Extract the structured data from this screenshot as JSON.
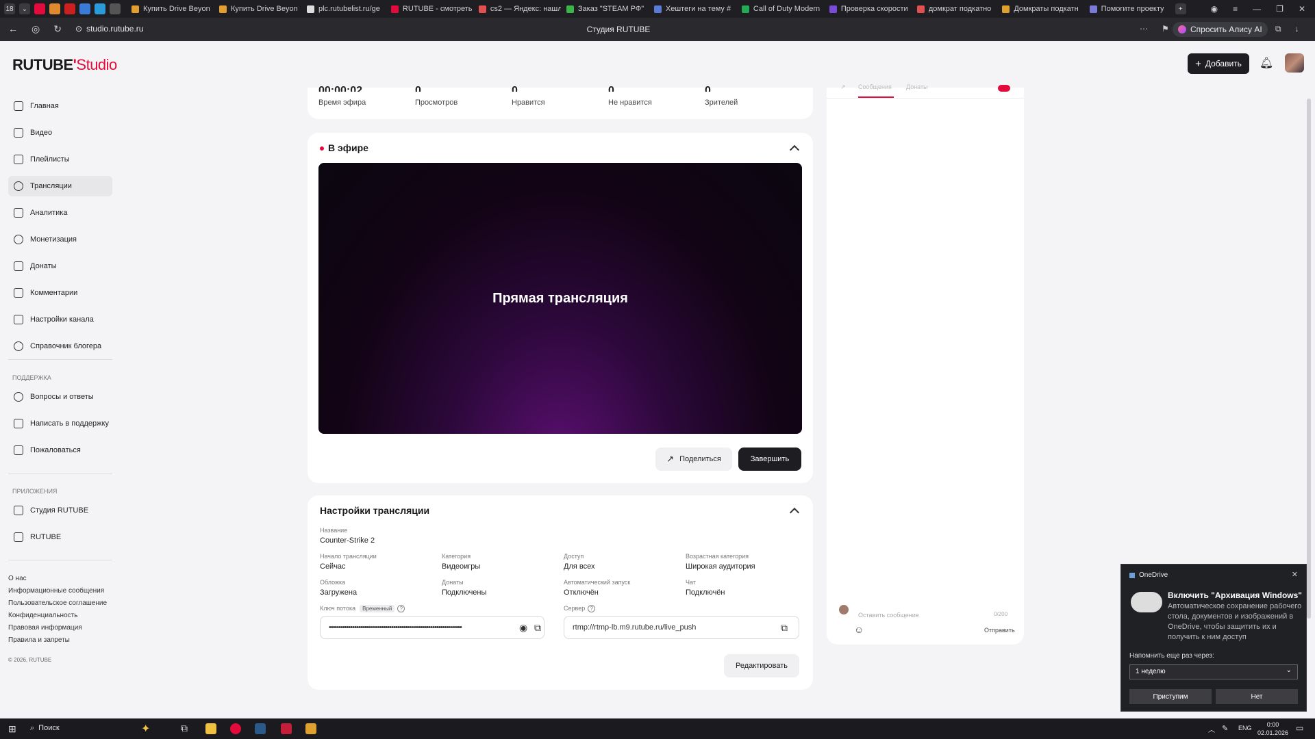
{
  "browser": {
    "tabs": [
      {
        "label": "Купить Drive Beyon",
        "color": "#e0a030"
      },
      {
        "label": "Купить Drive Beyon",
        "color": "#e0a030"
      },
      {
        "label": "plc.rutubelist.ru/ge",
        "color": "#dddddd"
      },
      {
        "label": "RUTUBE - смотреть",
        "color": "#e30b3b"
      },
      {
        "label": "cs2 — Яндекс: нашл",
        "color": "#e35050"
      },
      {
        "label": "Заказ \"STEAM РФ\"",
        "color": "#3bb54a"
      },
      {
        "label": "Хештеги на тему #",
        "color": "#5a7bd8"
      },
      {
        "label": "Call of Duty Modern",
        "color": "#22aa55"
      },
      {
        "label": "Проверка скорости",
        "color": "#7a4ad8"
      },
      {
        "label": "домкрат подкатно",
        "color": "#e35050"
      },
      {
        "label": "Домкраты подкатн",
        "color": "#e0a030"
      },
      {
        "label": "Помогите проекту",
        "color": "#7a7ad8"
      }
    ],
    "tab_count": "18",
    "address": "studio.rutube.ru",
    "page_title": "Студия RUTUBE",
    "alisa_label": "Спросить Алису AI"
  },
  "header": {
    "logo_main": "RUTUBE",
    "logo_studio": "Studio",
    "add_label": "Добавить"
  },
  "sidebar": {
    "items": [
      {
        "label": "Главная",
        "icon": "home-icon"
      },
      {
        "label": "Видео",
        "icon": "video-icon"
      },
      {
        "label": "Плейлисты",
        "icon": "playlist-icon"
      },
      {
        "label": "Трансляции",
        "icon": "broadcast-icon"
      },
      {
        "label": "Аналитика",
        "icon": "analytics-icon"
      },
      {
        "label": "Монетизация",
        "icon": "monetization-icon"
      },
      {
        "label": "Донаты",
        "icon": "donations-icon"
      },
      {
        "label": "Комментарии",
        "icon": "comments-icon"
      },
      {
        "label": "Настройки канала",
        "icon": "gear-icon"
      },
      {
        "label": "Справочник блогера",
        "icon": "info-icon"
      }
    ],
    "support_title": "ПОДДЕРЖКА",
    "support_items": [
      {
        "label": "Вопросы и ответы",
        "icon": "question-icon"
      },
      {
        "label": "Написать в поддержку",
        "icon": "mail-icon"
      },
      {
        "label": "Пожаловаться",
        "icon": "flag-icon"
      }
    ],
    "apps_title": "ПРИЛОЖЕНИЯ",
    "apps_items": [
      {
        "label": "Студия RUTUBE",
        "icon": "studio-icon"
      },
      {
        "label": "RUTUBE",
        "icon": "rutube-icon"
      }
    ],
    "footer_links": [
      "О нас",
      "Информационные сообщения",
      "Пользовательское соглашение",
      "Конфиденциальность",
      "Правовая информация",
      "Правила и запреты"
    ],
    "copyright": "© 2026, RUTUBE"
  },
  "stats": [
    {
      "label": "Время эфира",
      "value": "00:00:02"
    },
    {
      "label": "Просмотров",
      "value": "0"
    },
    {
      "label": "Нравится",
      "value": "0"
    },
    {
      "label": "Не нравится",
      "value": "0"
    },
    {
      "label": "Зрителей",
      "value": "0"
    }
  ],
  "live": {
    "title": "В эфире",
    "player_text": "Прямая трансляция",
    "share_label": "Поделиться",
    "finish_label": "Завершить"
  },
  "settings": {
    "title": "Настройки трансляции",
    "name_label": "Название",
    "name_value": "Counter-Strike 2",
    "fields": [
      {
        "label": "Начало трансляции",
        "value": "Сейчас"
      },
      {
        "label": "Категория",
        "value": "Видеоигры"
      },
      {
        "label": "Доступ",
        "value": "Для всех"
      },
      {
        "label": "Возрастная категория",
        "value": "Широкая аудитория"
      },
      {
        "label": "Обложка",
        "value": "Загружена"
      },
      {
        "label": "Донаты",
        "value": "Подключены"
      },
      {
        "label": "Автоматический запуск",
        "value": "Отключён"
      },
      {
        "label": "Чат",
        "value": "Подключён"
      }
    ],
    "key_label": "Ключ потока",
    "key_badge": "Временный",
    "key_value": "••••••••••••••••••••••••••••••••••••••••••••••••••••••••••••••••••••",
    "server_label": "Сервер",
    "server_value": "rtmp://rtmp-lb.m9.rutube.ru/live_push",
    "edit_label": "Редактировать"
  },
  "chat": {
    "tab_messages": "Сообщения",
    "tab_donations": "Донаты",
    "placeholder": "Оставить сообщение",
    "counter": "0/200",
    "send_label": "Отправить"
  },
  "onedrive": {
    "app": "OneDrive",
    "title": "Включить \"Архивация Windows\"",
    "text": "Автоматическое сохранение рабочего стола, документов и изображений в OneDrive, чтобы защитить их и получить к ним доступ",
    "remind_label": "Напомнить еще раз через:",
    "remind_value": "1 неделю",
    "accept_label": "Приступим",
    "decline_label": "Нет"
  },
  "taskbar": {
    "search_label": "Поиск",
    "lang": "ENG",
    "time": "0:00",
    "date": "02.01.2026"
  },
  "colors": {
    "accent": "#e30b3b",
    "dark_button": "#1d1d22"
  }
}
